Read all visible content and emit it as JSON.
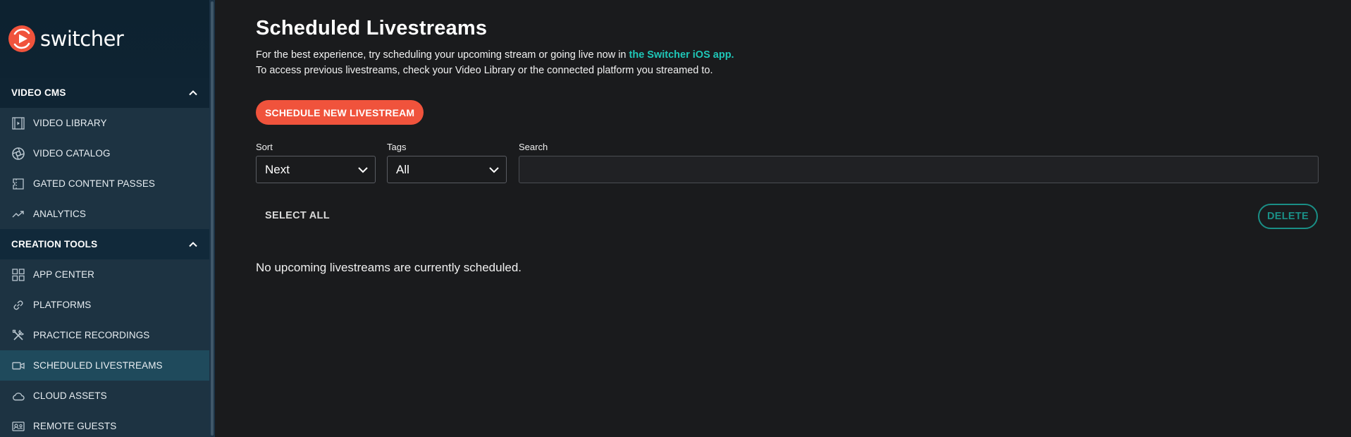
{
  "brand": {
    "name": "switcher",
    "accent": "#f0533c",
    "link_color": "#1fc7b8"
  },
  "sidebar": {
    "sections": [
      {
        "title": "VIDEO CMS",
        "items": [
          {
            "label": "VIDEO LIBRARY",
            "icon": "film-icon"
          },
          {
            "label": "VIDEO CATALOG",
            "icon": "aperture-icon"
          },
          {
            "label": "GATED CONTENT PASSES",
            "icon": "ticket-icon"
          },
          {
            "label": "ANALYTICS",
            "icon": "trend-icon"
          }
        ]
      },
      {
        "title": "CREATION TOOLS",
        "items": [
          {
            "label": "APP CENTER",
            "icon": "grid-icon"
          },
          {
            "label": "PLATFORMS",
            "icon": "link-icon"
          },
          {
            "label": "PRACTICE RECORDINGS",
            "icon": "tools-icon"
          },
          {
            "label": "SCHEDULED LIVESTREAMS",
            "icon": "video-camera-icon",
            "active": true
          },
          {
            "label": "CLOUD ASSETS",
            "icon": "cloud-icon"
          },
          {
            "label": "REMOTE GUESTS",
            "icon": "guests-icon"
          }
        ]
      }
    ]
  },
  "main": {
    "title": "Scheduled Livestreams",
    "subtitle_line1_prefix": "For the best experience, try scheduling your upcoming stream or going live now in ",
    "subtitle_link": "the Switcher iOS app.",
    "subtitle_line2": "To access previous livestreams, check your Video Library or the connected platform you streamed to.",
    "primary_button": "SCHEDULE NEW LIVESTREAM",
    "filters": {
      "sort_label": "Sort",
      "sort_value": "Next",
      "tags_label": "Tags",
      "tags_value": "All",
      "search_label": "Search",
      "search_value": "",
      "search_placeholder": ""
    },
    "select_all": "SELECT ALL",
    "delete": "DELETE",
    "empty_message": "No upcoming livestreams are currently scheduled."
  }
}
